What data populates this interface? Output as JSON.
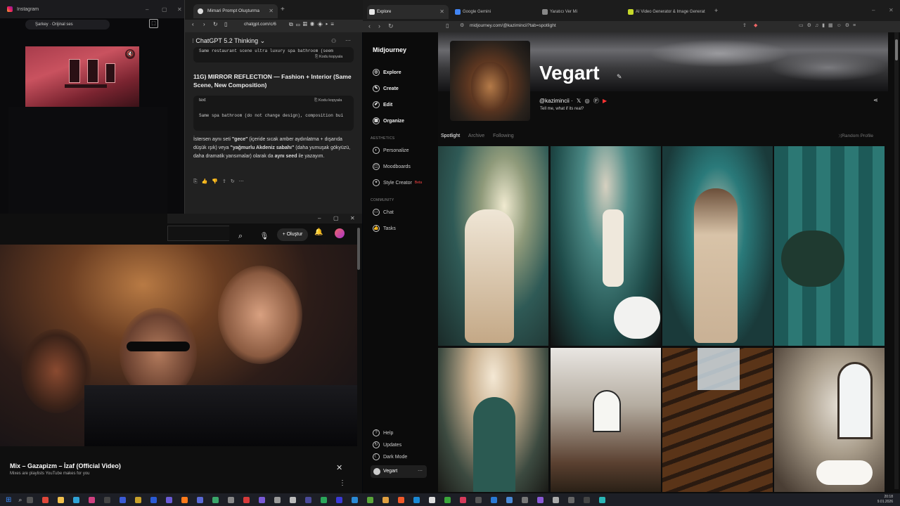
{
  "instagram": {
    "title": "Instagram",
    "audio": "Şarkey · Orijinal ses"
  },
  "chatgpt": {
    "tab_title": "Mimari Prompt Oluşturma",
    "url": "chatgpt.com/c/6",
    "model": "ChatGPT 5.2 Thinking",
    "code_top": "Same restaurant scene ultra luxury spa bathroom (seem",
    "copy_label": "Kodu kopyala",
    "section_title": "11G) MIRROR REFLECTION — Fashion + Interior (Same Scene, New Composition)",
    "code_lang": "text",
    "code_line": "Same spa bathroom (do not change design), composition bui",
    "para_1": "İstersen aynı seti ",
    "para_gece": "\"gece\"",
    "para_2": " (içeride sıcak amber aydınlatma + dışarıda düşük ışık) veya ",
    "para_sabah": "\"yağmurlu Akdeniz sabahı\"",
    "para_3": " (daha yumuşak gökyüzü, daha dramatik yansımalar) olarak da ",
    "para_ayni": "aynı seed",
    "para_4": " ile yazayım."
  },
  "youtube": {
    "create_label": "Oluştur",
    "video_title": "Mix – Gazapizm – İzaf (Official Video)",
    "video_sub": "Mixes are playlists YouTube makes for you"
  },
  "midjourney": {
    "tabs": [
      {
        "label": "Explore",
        "color": "#e8e8e8"
      },
      {
        "label": "Google Gemini",
        "color": "#4285f4"
      },
      {
        "label": "Yaratıcı Ver Mi",
        "color": "#888888"
      },
      {
        "label": "AI Video Generator & Image Generat",
        "color": "#c6d82a"
      }
    ],
    "url": "midjourney.com/@kazimincii?tab=spotlight",
    "brand": "Midjourney",
    "nav": [
      "Explore",
      "Create",
      "Edit",
      "Organize"
    ],
    "aesthetics_label": "AESTHETICS",
    "aesthetics": [
      "Personalize",
      "Moodboards",
      "Style Creator"
    ],
    "beta": "Beta",
    "community_label": "COMMUNITY",
    "community": [
      "Chat",
      "Tasks"
    ],
    "bottom": [
      "Help",
      "Updates",
      "Dark Mode"
    ],
    "user": "Vegart",
    "profile_name": "Vegart",
    "handle": "@kazimincii",
    "bio": "Tell me, what if its real?",
    "profile_tabs": [
      "Spotlight",
      "Archive",
      "Following"
    ],
    "random_profile": "Random Profile"
  },
  "taskbar": {
    "time": "20:18",
    "date": "9.01.2026"
  }
}
